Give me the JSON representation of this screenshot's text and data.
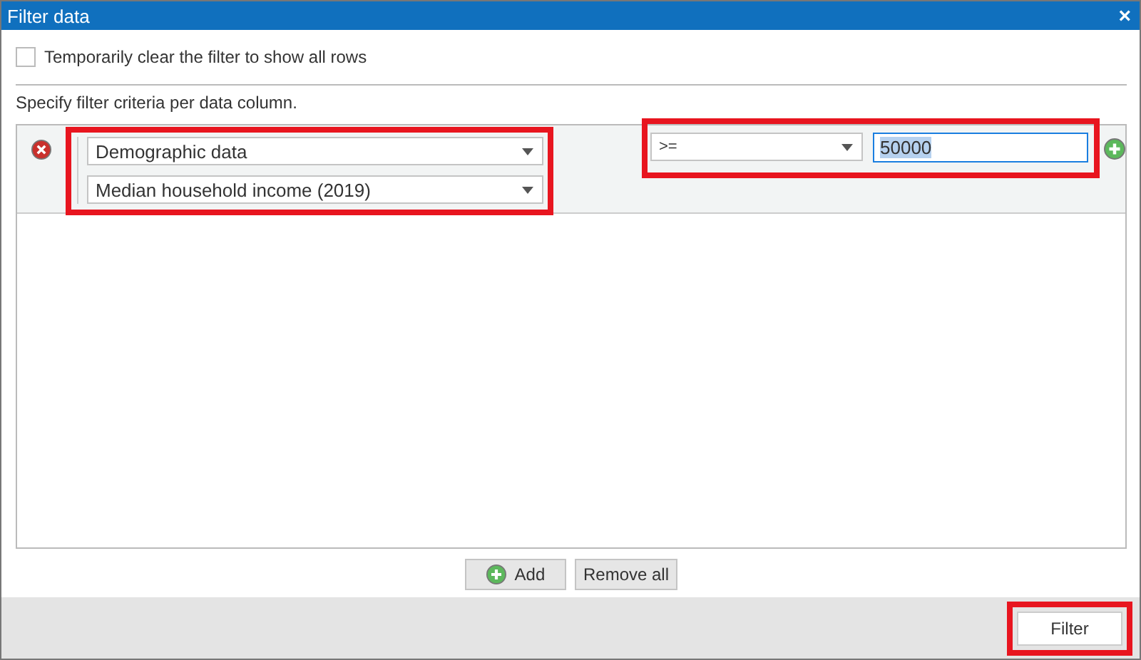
{
  "window": {
    "title": "Filter data",
    "close": "×"
  },
  "clear_filter": {
    "label": "Temporarily clear the filter to show all rows",
    "checked": false
  },
  "instructions": "Specify filter criteria per data column.",
  "criteria": [
    {
      "column_group": {
        "value": "Demographic data",
        "highlighted": true
      },
      "column": "Median household income (2019)",
      "operator": {
        "value": ">=",
        "highlighted": true
      },
      "value": "50000",
      "value_focused": true
    }
  ],
  "buttons": {
    "add": "Add",
    "remove_all": "Remove all"
  },
  "footer": {
    "filter_button": {
      "label": "Filter",
      "highlighted": true
    }
  }
}
